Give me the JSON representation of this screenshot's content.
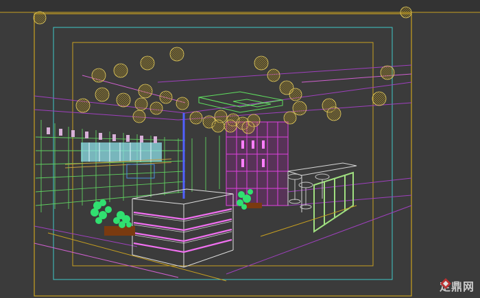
{
  "viewport": {
    "type": "3D wireframe viewport",
    "colors": {
      "background": "#3b3b3b",
      "safe_frame_outer": "#c8a020",
      "safe_frame_action": "#3fc8c8",
      "safe_frame_title": "#c8a020",
      "pendant_lamps": "#e8d060",
      "cabinet_lights": "#e060e0",
      "shelving": "#60d060",
      "walls": "#b040d0",
      "plants": "#30e070"
    }
  },
  "watermark": {
    "text": "定鼎网",
    "icon": "logo-icon"
  }
}
